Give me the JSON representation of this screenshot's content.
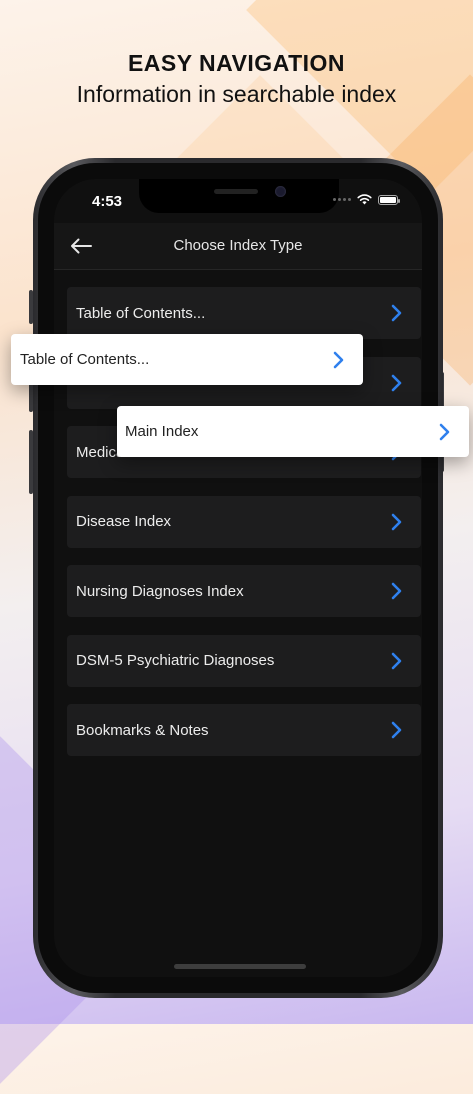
{
  "headline": {
    "title": "EASY NAVIGATION",
    "subtitle": "Information in searchable index"
  },
  "status": {
    "time": "4:53"
  },
  "navbar": {
    "title": "Choose Index Type"
  },
  "list": {
    "items": [
      {
        "label": "Table of Contents..."
      },
      {
        "label": ""
      },
      {
        "label": "Medica"
      },
      {
        "label": "Disease Index"
      },
      {
        "label": "Nursing Diagnoses Index"
      },
      {
        "label": "DSM-5 Psychiatric Diagnoses"
      },
      {
        "label": "Bookmarks & Notes"
      }
    ]
  },
  "popouts": {
    "first": {
      "label": "Table of Contents..."
    },
    "second": {
      "label": "Main Index"
    }
  },
  "colors": {
    "accent": "#2f80ed",
    "screen_bg": "#101010",
    "row_bg": "#1d1d1e"
  },
  "icons": {
    "back": "arrow-left-icon",
    "row": "chevron-right-icon"
  }
}
